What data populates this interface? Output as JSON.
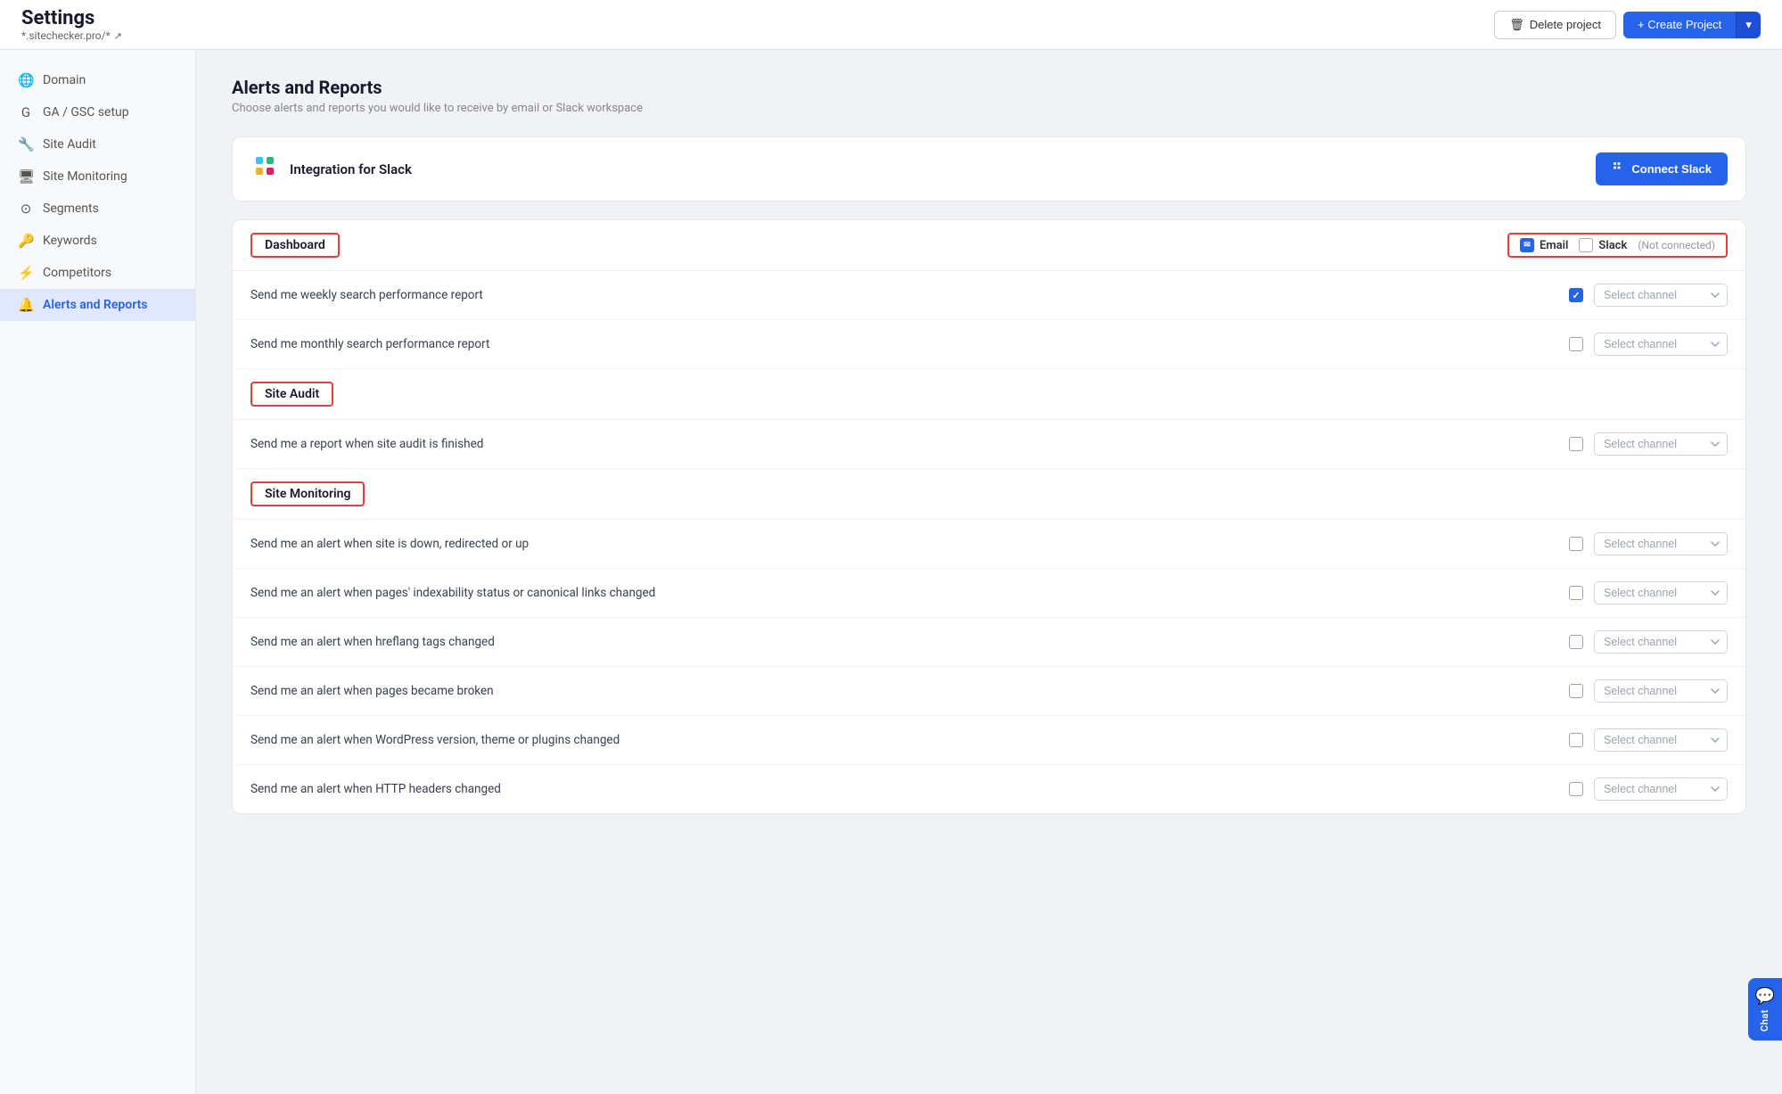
{
  "topbar": {
    "title": "Settings",
    "subtitle": "*.sitechecker.pro/*",
    "subtitle_icon": "external-link",
    "delete_label": "Delete project",
    "create_label": "+ Create Project"
  },
  "sidebar": {
    "items": [
      {
        "id": "domain",
        "label": "Domain",
        "icon": "🌐",
        "active": false
      },
      {
        "id": "ga-gsc",
        "label": "GA / GSC setup",
        "icon": "G",
        "active": false
      },
      {
        "id": "site-audit",
        "label": "Site Audit",
        "icon": "🔧",
        "active": false
      },
      {
        "id": "site-monitoring",
        "label": "Site Monitoring",
        "icon": "🖥",
        "active": false
      },
      {
        "id": "segments",
        "label": "Segments",
        "icon": "⊙",
        "active": false
      },
      {
        "id": "keywords",
        "label": "Keywords",
        "icon": "🔑",
        "active": false
      },
      {
        "id": "competitors",
        "label": "Competitors",
        "icon": "⚡",
        "active": false
      },
      {
        "id": "alerts-reports",
        "label": "Alerts and Reports",
        "icon": "🔔",
        "active": true
      }
    ]
  },
  "page": {
    "title": "Alerts and Reports",
    "subtitle": "Choose alerts and reports you would like to receive by email or Slack workspace"
  },
  "slack_integration": {
    "logo": "slack",
    "title": "Integration for Slack",
    "connect_label": "Connect Slack",
    "connect_icon": "slack"
  },
  "sections": [
    {
      "id": "dashboard",
      "title": "Dashboard",
      "email_label": "Email",
      "slack_label": "Slack",
      "not_connected": "(Not connected)",
      "items": [
        {
          "text": "Send me weekly search performance report",
          "email_checked": true,
          "slack_value": "Select channel"
        },
        {
          "text": "Send me monthly search performance report",
          "email_checked": false,
          "slack_value": "Select channel"
        }
      ]
    },
    {
      "id": "site-audit",
      "title": "Site Audit",
      "items": [
        {
          "text": "Send me a report when site audit is finished",
          "email_checked": false,
          "slack_value": "Select channel"
        }
      ]
    },
    {
      "id": "site-monitoring",
      "title": "Site Monitoring",
      "items": [
        {
          "text": "Send me an alert when site is down, redirected or up",
          "email_checked": false,
          "slack_value": "Select channel"
        },
        {
          "text": "Send me an alert when pages' indexability status or canonical links changed",
          "email_checked": false,
          "slack_value": "Select channel"
        },
        {
          "text": "Send me an alert when hreflang tags changed",
          "email_checked": false,
          "slack_value": "Select channel"
        },
        {
          "text": "Send me an alert when pages became broken",
          "email_checked": false,
          "slack_value": "Select channel"
        },
        {
          "text": "Send me an alert when WordPress version, theme or plugins changed",
          "email_checked": false,
          "slack_value": "Select channel"
        },
        {
          "text": "Send me an alert when HTTP headers changed",
          "email_checked": false,
          "slack_value": "Select channel"
        }
      ]
    }
  ],
  "chat_widget": {
    "label": "Chat",
    "icon": "💬"
  }
}
